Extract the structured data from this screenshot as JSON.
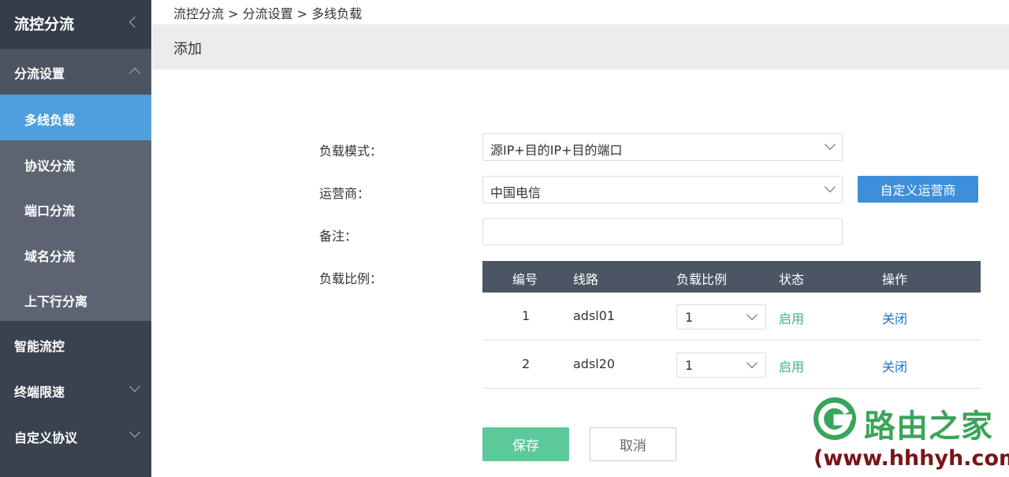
{
  "sidebar": {
    "title": "流控分流",
    "group": "分流设置",
    "sub_items": [
      "多线负载",
      "协议分流",
      "端口分流",
      "域名分流",
      "上下行分离"
    ],
    "items": [
      "智能流控",
      "终端限速",
      "自定义协议"
    ]
  },
  "breadcrumb": "流控分流 > 分流设置 > 多线负载",
  "panel": {
    "title": "添加"
  },
  "form": {
    "mode_label": "负载模式：",
    "mode_value": "源IP+目的IP+目的端口",
    "isp_label": "运营商：",
    "isp_value": "中国电信",
    "custom_isp_button": "自定义运营商",
    "note_label": "备注：",
    "note_value": "",
    "ratio_label": "负载比例："
  },
  "table": {
    "headers": [
      "编号",
      "线路",
      "负载比例",
      "状态",
      "操作"
    ],
    "rows": [
      {
        "id": "1",
        "line": "adsl01",
        "ratio": "1",
        "status": "启用",
        "action": "关闭"
      },
      {
        "id": "2",
        "line": "adsl20",
        "ratio": "1",
        "status": "启用",
        "action": "关闭"
      }
    ]
  },
  "buttons": {
    "save": "保存",
    "cancel": "取消"
  },
  "watermark": {
    "name": "路由之家",
    "url": "(www.hhhyh.com)"
  },
  "colors": {
    "sidebar": "#39424f",
    "active": "#4e9fdc",
    "primary": "#3d8fd9",
    "save": "#5cc99a",
    "status": "#3fb67b"
  }
}
